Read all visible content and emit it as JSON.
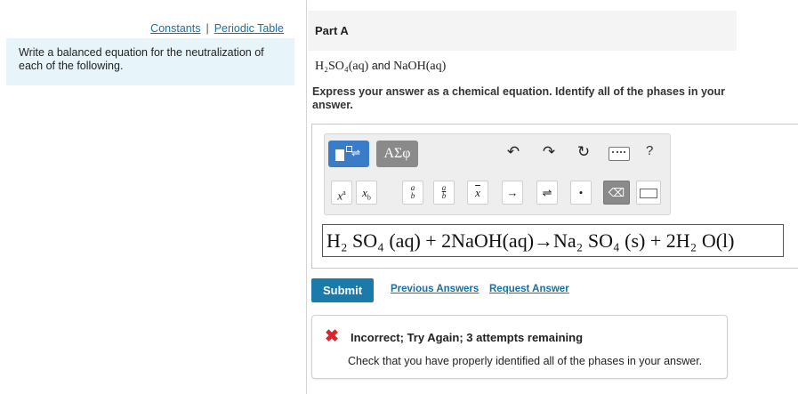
{
  "left": {
    "links": {
      "constants": "Constants",
      "separator": "|",
      "periodic_table": "Periodic Table"
    },
    "instructions": "Write a balanced equation for the neutralization of each of the following."
  },
  "part": {
    "title": "Part A"
  },
  "question": {
    "reactant1": "H₂SO₄(aq)",
    "conjunction": "and",
    "reactant2": "NaOH(aq)"
  },
  "prompt": "Express your answer as a chemical equation. Identify all of the phases in your answer.",
  "toolbar": {
    "greek_label": "ΑΣφ",
    "undo": "↶",
    "redo": "↷",
    "reset": "↻",
    "help": "?",
    "keys": {
      "superscript": "x",
      "superscript_exp": "a",
      "subscript": "x",
      "subscript_idx": "b",
      "fraction_num": "a",
      "fraction_den": "b",
      "frac2_num": "a",
      "frac2_den": "b",
      "overline": "x",
      "arrow": "→",
      "equilibrium": "⇌",
      "dot": "•",
      "backspace": "⌫"
    }
  },
  "answer": {
    "value": "H₂ SO₄ (aq) + 2NaOH(aq)→Na₂ SO₄ (s) + 2H₂ O(l)"
  },
  "actions": {
    "submit": "Submit",
    "previous_answers": "Previous Answers",
    "request_answer": "Request Answer"
  },
  "feedback": {
    "icon": "✖",
    "title": "Incorrect; Try Again; 3 attempts remaining",
    "message": "Check that you have properly identified all of the phases in your answer."
  },
  "colors": {
    "accent": "#1a7aaa",
    "error": "#d9252b",
    "info_bg": "#e7f5fb",
    "template_btn": "#3b7cc9"
  }
}
